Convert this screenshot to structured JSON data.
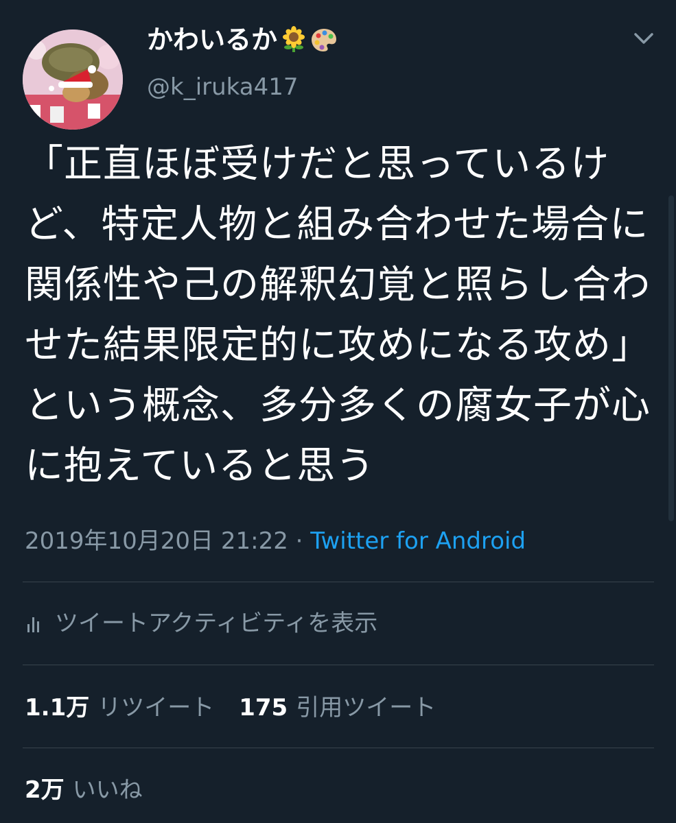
{
  "user": {
    "display_name": "かわいるか",
    "name_emojis": [
      "sunflower-emoji",
      "palette-emoji"
    ],
    "handle": "@k_iruka417"
  },
  "tweet": {
    "text": "「正直ほぼ受けだと思っているけど、特定人物と組み合わせた場合に関係性や己の解釈幻覚と照らし合わせた結果限定的に攻めになる攻め」という概念、多分多くの腐女子が心に抱えていると思う",
    "timestamp": "2019年10月20日 21:22",
    "separator": " · ",
    "source": "Twitter for Android"
  },
  "activity": {
    "label": "ツイートアクティビティを表示"
  },
  "stats": {
    "retweets": {
      "count": "1.1万",
      "label": "リツイート"
    },
    "quotes": {
      "count": "175",
      "label": "引用ツイート"
    },
    "likes": {
      "count": "2万",
      "label": "いいね"
    }
  },
  "colors": {
    "background": "#15202b",
    "secondary_text": "#8899a6",
    "link": "#1da1f2",
    "divider": "#38444d"
  },
  "icons": {
    "menu": "chevron-down-icon",
    "activity": "bar-chart-icon"
  }
}
